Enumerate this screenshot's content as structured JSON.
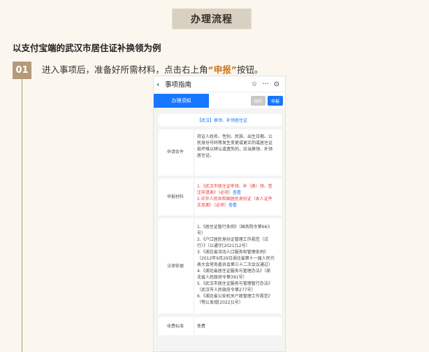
{
  "banner": "办理流程",
  "heading": "以支付宝端的武汉市居住证补换领为例",
  "step": {
    "number": "01",
    "text_before": "进入事项后，准备好所需材料，点击右上角",
    "highlight": "“申报”",
    "text_after": "按钮。"
  },
  "phone": {
    "back_icon": "‹",
    "title": "事项指南",
    "icons": {
      "star": "☆",
      "more": "···",
      "target": "⊙"
    },
    "tab_active": "办理须知",
    "btn_gray": "预约",
    "btn_blue": "申报",
    "item_title": "【武汉】换领、补领居住证",
    "rows": [
      {
        "label": "申请条件",
        "lines": [
          "持证人姓名、性别、民族、出生日期、公",
          "民身份号码等发生变更或更正的或居住证",
          "损坏难以辨认或遗失的，应当换领、补领",
          "居住证。"
        ]
      },
      {
        "label": "申报材料",
        "material1_a": "1.《武汉市居住证申领、补（换）领、签",
        "material1_b": "注申请表》（必须）",
        "view": "查看",
        "material2_a": "2.中华人民共和国居民身份证（本人证件",
        "material2_b": "正反面）（必须）"
      },
      {
        "label": "法律依据",
        "lines": [
          "1.《居住证暂行条例》（国务院令第663",
          "号）",
          "2.《户口居民身份证管理工作规范（试",
          "行）》（公通字[2021]12号）",
          "3.《湖北省流动人口服务和管理条例》",
          "（2012年9月29日湖北省第十一届人民代",
          "表大会常务委员会第三十二次会议通过）",
          "4.《湖北省居住证服务与管理办法》（湖",
          "北省人民政府令第391号）",
          "5.《武汉市居住证服务与管理暂行办法》",
          "（武汉市人民政府令第277号）",
          "6.《湖北省公安机关户政管理工作规范》",
          "（鄂公发规[2022]1号）"
        ]
      },
      {
        "label": "收费标准",
        "value": "免费"
      }
    ]
  }
}
